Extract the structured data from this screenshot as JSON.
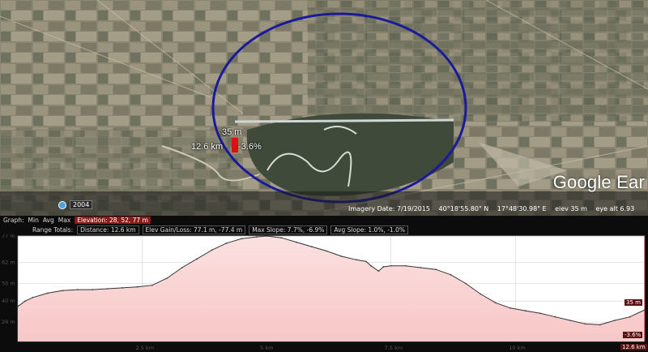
{
  "map": {
    "watermark": "Google Ear",
    "year_badge": "2004",
    "marker": {
      "elevation": "35 m",
      "distance": "12.6 km",
      "slope": "-3.6%"
    },
    "status": {
      "imagery_date": "Imagery Date: 7/19/2015",
      "lat": "40°18'55.80\" N",
      "lon": "17°48'30.98\" E",
      "elev": "elev   35 m",
      "eye_alt": "eye alt   6.93"
    }
  },
  "profile_toolbar": {
    "graph_label": "Graph:",
    "min": "Min",
    "avg": "Avg",
    "max": "Max",
    "elevation": "Elevation: 28, 52, 77 m",
    "range_totals": "Range Totals:",
    "distance": "Distance: 12.6 km",
    "elev_gain_loss": "Elev Gain/Loss: 77.1 m, -77.4 m",
    "max_slope": "Max Slope: 7.7%, -6.9%",
    "avg_slope": "Avg Slope: 1.0%, -1.0%"
  },
  "profile_end": {
    "elevation": "35 m",
    "slope": "-3.6%",
    "distance": "12.6 km"
  },
  "chart_data": {
    "type": "area",
    "x_unit": "km",
    "y_unit": "m",
    "xlim": [
      0,
      12.6
    ],
    "ylim": [
      17,
      77
    ],
    "y_ticks": [
      "77 m",
      "62 m",
      "50 m",
      "40 m",
      "28 m"
    ],
    "y_tick_values": [
      77,
      62,
      50,
      40,
      28
    ],
    "x_ticks": [
      "2.5 km",
      "5 km",
      "7.5 km",
      "10 km",
      "12.6 km"
    ],
    "x_tick_values": [
      2.5,
      5,
      7.5,
      10,
      12.6
    ],
    "grid": true,
    "color": "#f8c7c7",
    "line_color": "#333333",
    "x": [
      0,
      0.15,
      0.3,
      0.6,
      0.9,
      1.2,
      1.5,
      1.8,
      2.1,
      2.4,
      2.7,
      3.0,
      3.3,
      3.6,
      3.9,
      4.2,
      4.5,
      4.8,
      5.0,
      5.3,
      5.6,
      5.9,
      6.2,
      6.5,
      6.8,
      7.0,
      7.1,
      7.25,
      7.35,
      7.5,
      7.8,
      8.1,
      8.4,
      8.7,
      9.0,
      9.3,
      9.6,
      9.9,
      10.2,
      10.5,
      10.8,
      11.1,
      11.4,
      11.7,
      12.0,
      12.3,
      12.6
    ],
    "y": [
      37,
      40,
      42,
      44.5,
      46,
      46.5,
      46.5,
      47,
      47.5,
      48,
      49,
      53,
      59,
      64,
      69,
      73,
      75.5,
      76.5,
      77,
      76,
      73.5,
      71,
      68.5,
      65.5,
      63.5,
      62.5,
      60,
      57,
      59.5,
      60,
      60,
      59,
      58,
      55,
      50,
      44,
      39,
      36,
      34.5,
      33,
      31,
      29,
      27,
      26.5,
      29,
      31,
      35
    ]
  }
}
